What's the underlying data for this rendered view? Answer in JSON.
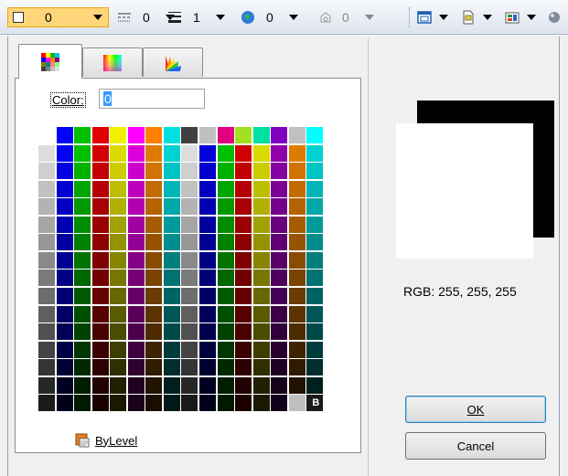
{
  "toolbar": {
    "items": [
      {
        "value": "0"
      },
      {
        "value": "0"
      },
      {
        "value": "1"
      },
      {
        "value": "0"
      },
      {
        "value": "0"
      }
    ]
  },
  "dialog": {
    "tabs": [
      "index-color-tab",
      "true-color-tab",
      "color-book-tab"
    ],
    "color_label": "Color:",
    "color_value": "0",
    "bylevel_label": "ByLevel",
    "grid_selected_marker": "B",
    "rgb_text": "RGB: 255, 255, 255",
    "ok_label": "OK",
    "cancel_label": "Cancel"
  },
  "colors": {
    "accent_border": "#3c7fb1",
    "toolbar_selected": "#ffd77a",
    "preview_color": "#ffffff"
  }
}
